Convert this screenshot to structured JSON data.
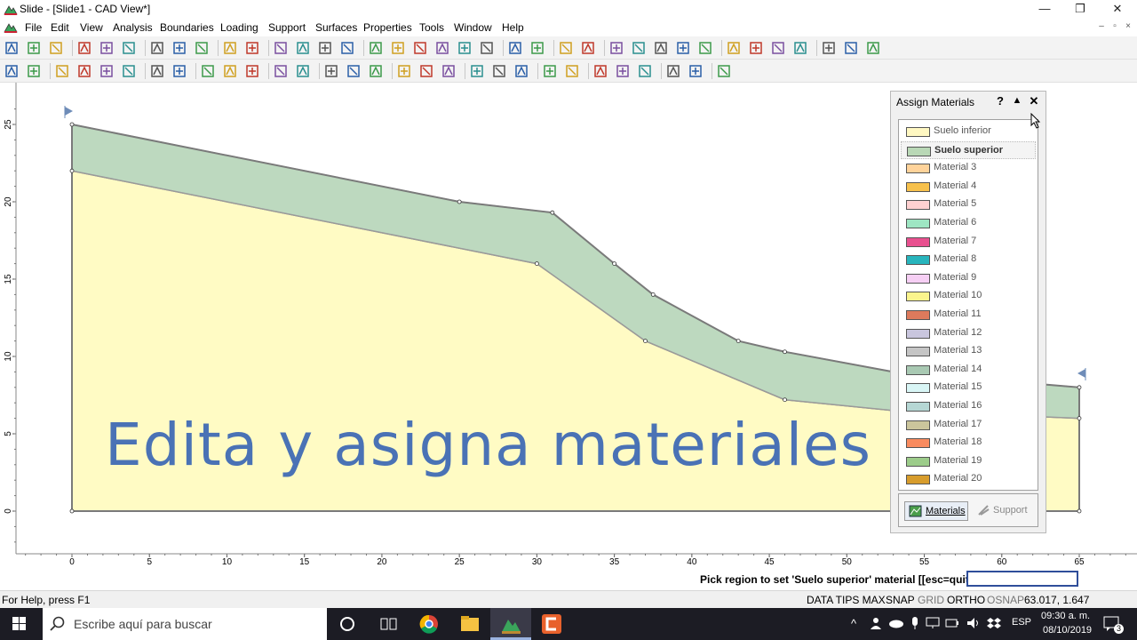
{
  "window": {
    "title": "Slide - [Slide1 - CAD View*]",
    "minimize": "—",
    "maximize": "❐",
    "close": "✕"
  },
  "menu": {
    "items": [
      "File",
      "Edit",
      "View",
      "Analysis",
      "Boundaries",
      "Loading",
      "Support",
      "Surfaces",
      "Properties",
      "Tools",
      "Window",
      "Help"
    ],
    "mdi_controls": [
      "–",
      "▫",
      "×"
    ]
  },
  "toolbar1_icons": [
    "new-icon",
    "open-icon",
    "save-icon",
    "preview-icon",
    "print-icon",
    "scale-icon",
    "copy-icon",
    "tile-icon",
    "colors-icon",
    "undo-icon",
    "redo-icon",
    "pan-icon",
    "tool-icon",
    "camera-icon",
    "erase-view-icon",
    "zoom-all-icon",
    "zoom-in-icon",
    "zoom-out-icon",
    "zoom-window-icon",
    "zoom-prev-icon",
    "zoom-next-icon",
    "zoom-mouse-icon",
    "view-icon",
    "slope-icon",
    "add-vertex-icon",
    "boundary-icon",
    "delete-icon",
    "move-icon",
    "move-vertex-icon",
    "tree-icon",
    "scissor-icon",
    "filter-icon",
    "pin-icon",
    "knife-icon",
    "snap-icon",
    "line-icon",
    "snap2-icon"
  ],
  "toolbar2_icons": [
    "project-icon",
    "settings-icon",
    "material-stack-icon",
    "material-a-icon",
    "material-b-icon",
    "material-c-icon",
    "vertex-edit-icon",
    "arrows-icon",
    "assign-icon",
    "flag-icon",
    "assign2-icon",
    "hand-select-icon",
    "table-icon",
    "grid-icon",
    "grid2-icon",
    "grid3-icon",
    "line-draw-icon",
    "arrow-draw-icon",
    "ruler-icon",
    "pencil-icon",
    "arc-icon",
    "polygon-icon",
    "rectangle-icon",
    "ellipse-icon",
    "image-icon",
    "triangle-icon",
    "dimension-icon",
    "angle-icon",
    "axis-icon",
    "eraser-icon"
  ],
  "overlay_title": "Edita y asigna materiales",
  "axes": {
    "y_ticks": [
      "0",
      "5",
      "10",
      "15",
      "20",
      "25"
    ],
    "x_ticks": [
      "0",
      "5",
      "10",
      "15",
      "20",
      "25",
      "30",
      "35",
      "40",
      "45",
      "50",
      "55",
      "60",
      "65"
    ]
  },
  "slope_model": {
    "units": "m",
    "upper_boundary": [
      [
        0,
        25
      ],
      [
        25,
        20
      ],
      [
        31,
        19.3
      ],
      [
        35,
        16
      ],
      [
        37.5,
        14
      ],
      [
        43,
        11
      ],
      [
        46,
        10.3
      ],
      [
        53,
        9
      ],
      [
        65,
        8
      ]
    ],
    "lower_material_top": [
      [
        0,
        22
      ],
      [
        30,
        16
      ],
      [
        37,
        11
      ],
      [
        46,
        7.2
      ],
      [
        53,
        6.5
      ],
      [
        65,
        6
      ]
    ],
    "bottom": 0,
    "x_range": [
      0,
      65
    ],
    "colors": {
      "suelo_superior": "#bdd9bf",
      "suelo_inferior": "#fffbc4",
      "boundary": "#7a7a7a"
    }
  },
  "assign_materials": {
    "title": "Assign Materials",
    "help": "?",
    "collapse": "▲",
    "close": "✕",
    "selected": "Suelo superior",
    "materials": [
      {
        "name": "Suelo inferior",
        "color": "#fff8c2"
      },
      {
        "name": "Suelo superior",
        "color": "#b9d8b6"
      },
      {
        "name": "Material 3",
        "color": "#ffd39a"
      },
      {
        "name": "Material 4",
        "color": "#f7c14c"
      },
      {
        "name": "Material 5",
        "color": "#ffd1d1"
      },
      {
        "name": "Material 6",
        "color": "#9ee6c3"
      },
      {
        "name": "Material 7",
        "color": "#e8508f"
      },
      {
        "name": "Material 8",
        "color": "#28b5bd"
      },
      {
        "name": "Material 9",
        "color": "#f6cff4"
      },
      {
        "name": "Material 10",
        "color": "#fbf48d"
      },
      {
        "name": "Material 11",
        "color": "#dd7a5c"
      },
      {
        "name": "Material 12",
        "color": "#c9c6de"
      },
      {
        "name": "Material 13",
        "color": "#c5c5c5"
      },
      {
        "name": "Material 14",
        "color": "#a9c9b3"
      },
      {
        "name": "Material 15",
        "color": "#d9f6f6"
      },
      {
        "name": "Material 16",
        "color": "#b6d7d4"
      },
      {
        "name": "Material 17",
        "color": "#cbc59c"
      },
      {
        "name": "Material 18",
        "color": "#f98b5f"
      },
      {
        "name": "Material 19",
        "color": "#9ccc8a"
      },
      {
        "name": "Material 20",
        "color": "#d79c2c"
      }
    ],
    "tabs": {
      "materials": "Materials",
      "support": "Support"
    }
  },
  "prompt": {
    "text": "Pick region to set 'Suelo superior' material [[esc=quit]]",
    "input_value": ""
  },
  "statusbar": {
    "help": "For Help, press F1",
    "data_tips": "DATA TIPS MAX",
    "snap": "SNAP",
    "grid": "GRID",
    "ortho": "ORTHO",
    "osnap": "OSNAP",
    "coords": "63.017,  1.647"
  },
  "taskbar": {
    "search_placeholder": "Escribe aquí para buscar",
    "language": "ESP",
    "time": "09:30 a. m.",
    "date": "08/10/2019",
    "notifications": "3"
  }
}
